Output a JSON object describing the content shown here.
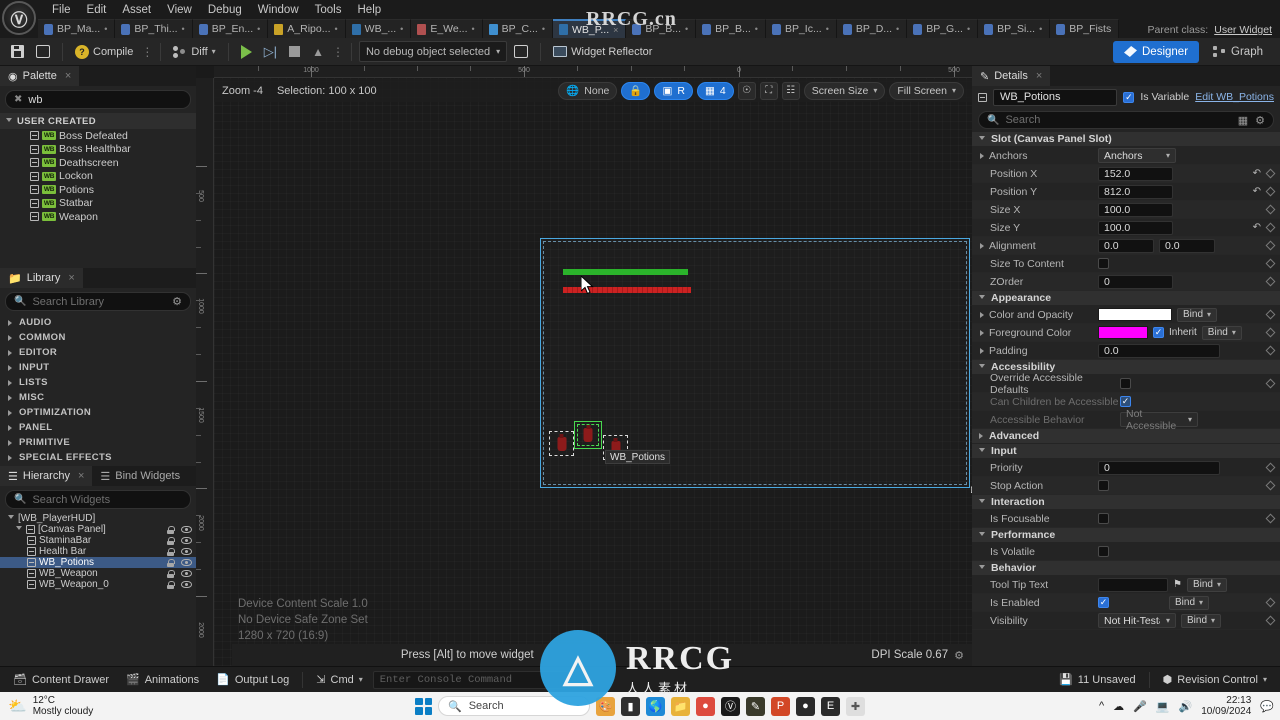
{
  "app": {
    "logo": "unreal-engine-logo",
    "menu": [
      "File",
      "Edit",
      "Asset",
      "View",
      "Debug",
      "Window",
      "Tools",
      "Help"
    ],
    "parent_class_label": "Parent class:",
    "parent_class_value": "User Widget"
  },
  "tabs": [
    {
      "label": "BP_Ma...",
      "icon": "blueprint-icon",
      "active": false,
      "dirty": false
    },
    {
      "label": "BP_Thi...",
      "icon": "blueprint-icon",
      "active": false,
      "dirty": false
    },
    {
      "label": "BP_En...",
      "icon": "blueprint-icon",
      "active": false,
      "dirty": false
    },
    {
      "label": "A_Ripo...",
      "icon": "animation-icon",
      "active": false,
      "dirty": false
    },
    {
      "label": "WB_...",
      "icon": "widget-icon",
      "active": false,
      "dirty": true
    },
    {
      "label": "E_We...",
      "icon": "enum-icon",
      "active": false,
      "dirty": true
    },
    {
      "label": "BP_C...",
      "icon": "curve-icon",
      "active": false,
      "dirty": true
    },
    {
      "label": "WB_P...",
      "icon": "widget-icon",
      "active": true,
      "dirty": false,
      "close": "x"
    },
    {
      "label": "BP_B...",
      "icon": "blueprint-icon",
      "active": false,
      "dirty": true
    },
    {
      "label": "BP_B...",
      "icon": "blueprint-icon",
      "active": false,
      "dirty": true
    },
    {
      "label": "BP_Ic...",
      "icon": "blueprint-icon",
      "active": false,
      "dirty": true
    },
    {
      "label": "BP_D...",
      "icon": "blueprint-icon",
      "active": false,
      "dirty": true
    },
    {
      "label": "BP_G...",
      "icon": "blueprint-icon",
      "active": false,
      "dirty": true
    },
    {
      "label": "BP_Si...",
      "icon": "blueprint-icon",
      "active": false,
      "dirty": true
    },
    {
      "label": "BP_Fists",
      "icon": "blueprint-icon",
      "active": false,
      "dirty": false
    }
  ],
  "toolbar": {
    "save_label": "",
    "browse_label": "",
    "compile_label": "Compile",
    "diff_label": "Diff",
    "debug_object": "No debug object selected",
    "widget_reflector": "Widget Reflector",
    "designer_label": "Designer",
    "graph_label": "Graph"
  },
  "palette": {
    "tab_label": "Palette",
    "search_value": "wb",
    "category": "USER CREATED",
    "items": [
      {
        "label": "Boss Defeated",
        "badge": "WB"
      },
      {
        "label": "Boss Healthbar",
        "badge": "WB"
      },
      {
        "label": "Deathscreen",
        "badge": "WB"
      },
      {
        "label": "Lockon",
        "badge": "WB"
      },
      {
        "label": "Potions",
        "badge": "WB"
      },
      {
        "label": "Statbar",
        "badge": "WB"
      },
      {
        "label": "Weapon",
        "badge": "WB"
      }
    ]
  },
  "library": {
    "tab_label": "Library",
    "search_placeholder": "Search Library",
    "categories": [
      "AUDIO",
      "COMMON",
      "EDITOR",
      "INPUT",
      "LISTS",
      "MISC",
      "OPTIMIZATION",
      "PANEL",
      "PRIMITIVE",
      "SPECIAL EFFECTS"
    ]
  },
  "hierarchy": {
    "tab_label": "Hierarchy",
    "tab_label_2": "Bind Widgets",
    "search_placeholder": "Search Widgets",
    "items": [
      {
        "label": "[WB_PlayerHUD]",
        "depth": 0,
        "selected": false,
        "controls": false
      },
      {
        "label": "[Canvas Panel]",
        "depth": 1,
        "selected": false,
        "controls": true
      },
      {
        "label": "StaminaBar",
        "depth": 2,
        "selected": false,
        "controls": true
      },
      {
        "label": "Health Bar",
        "depth": 2,
        "selected": false,
        "controls": true
      },
      {
        "label": "WB_Potions",
        "depth": 2,
        "selected": true,
        "controls": true
      },
      {
        "label": "WB_Weapon",
        "depth": 2,
        "selected": false,
        "controls": true
      },
      {
        "label": "WB_Weapon_0",
        "depth": 2,
        "selected": false,
        "controls": true
      }
    ]
  },
  "viewport": {
    "zoom_label": "Zoom -4",
    "selection_label": "Selection: 100 x 100",
    "none_label": "None",
    "grid_snap_value": "4",
    "rotation_label": "R",
    "screen_size_label": "Screen Size",
    "fill_screen_label": "Fill Screen",
    "device_content_scale": "Device Content Scale 1.0",
    "safe_zone": "No Device Safe Zone Set",
    "resolution": "1280 x 720 (16:9)",
    "hint": "Press [Alt] to move widget",
    "dpi_scale": "DPI Scale 0.67",
    "selected_widget_tag": "WB_Potions",
    "ruler_h_labels": [
      "1000",
      "500",
      "0",
      "500"
    ],
    "ruler_v_labels": [
      "500",
      "1000",
      "1500",
      "2000"
    ],
    "selection_color": "#4aa8e0",
    "widget_select_color": "#49d94f"
  },
  "details": {
    "tab_label": "Details",
    "widget_name": "WB_Potions",
    "is_variable_label": "Is Variable",
    "is_variable_checked": true,
    "edit_link": "Edit WB_Potions",
    "search_placeholder": "Search",
    "sections": [
      {
        "title": "Slot (Canvas Panel Slot)",
        "rows": [
          {
            "label": "Anchors",
            "type": "select",
            "value": "Anchors",
            "expand": true,
            "reset": false,
            "diamond": false
          },
          {
            "label": "Position X",
            "type": "text",
            "value": "152.0",
            "reset": true,
            "diamond": true
          },
          {
            "label": "Position Y",
            "type": "text",
            "value": "812.0",
            "reset": true,
            "diamond": true
          },
          {
            "label": "Size X",
            "type": "text",
            "value": "100.0",
            "reset": false,
            "diamond": true
          },
          {
            "label": "Size Y",
            "type": "text",
            "value": "100.0",
            "reset": true,
            "diamond": true
          },
          {
            "label": "Alignment",
            "type": "vec2",
            "value": "0.0",
            "value2": "0.0",
            "expand": true,
            "reset": false,
            "diamond": true
          },
          {
            "label": "Size To Content",
            "type": "check",
            "checked": false,
            "reset": false,
            "diamond": true
          },
          {
            "label": "ZOrder",
            "type": "text",
            "value": "0",
            "reset": false,
            "diamond": true
          }
        ]
      },
      {
        "title": "Appearance",
        "rows": [
          {
            "label": "Color and Opacity",
            "type": "color",
            "color": "#ffffff",
            "bind": "Bind",
            "expand": true,
            "diamond": true
          },
          {
            "label": "Foreground Color",
            "type": "color",
            "color": "#ff00ff",
            "inherit_label": "Inherit",
            "inherit_checked": true,
            "bind": "Bind",
            "expand": true,
            "diamond": true
          },
          {
            "label": "Padding",
            "type": "text",
            "value": "0.0",
            "expand": true,
            "wide": true,
            "diamond": true
          }
        ]
      },
      {
        "title": "Accessibility",
        "rows": [
          {
            "label": "Override Accessible Defaults",
            "type": "check",
            "checked": false,
            "diamond": true
          },
          {
            "label": "Can Children be Accessible",
            "type": "check",
            "checked": true,
            "dim": true,
            "diamond": false
          },
          {
            "label": "Accessible Behavior",
            "type": "select",
            "value": "Not Accessible",
            "dim": true,
            "diamond": false
          }
        ]
      },
      {
        "title": "Advanced",
        "collapsed": true,
        "rows": []
      },
      {
        "title": "Input",
        "rows": [
          {
            "label": "Priority",
            "type": "text",
            "value": "0",
            "diamond": true
          },
          {
            "label": "Stop Action",
            "type": "check",
            "checked": false,
            "diamond": true
          }
        ]
      },
      {
        "title": "Interaction",
        "rows": [
          {
            "label": "Is Focusable",
            "type": "check",
            "checked": false,
            "diamond": true
          }
        ]
      },
      {
        "title": "Performance",
        "rows": [
          {
            "label": "Is Volatile",
            "type": "check",
            "checked": false,
            "diamond": false
          }
        ]
      },
      {
        "title": "Behavior",
        "rows": [
          {
            "label": "Tool Tip Text",
            "type": "text",
            "value": "",
            "flag": true,
            "bind": "Bind",
            "diamond": false
          },
          {
            "label": "Is Enabled",
            "type": "check",
            "checked": true,
            "bind": "Bind",
            "diamond": true
          },
          {
            "label": "Visibility",
            "type": "select",
            "value": "Not Hit-Testable (S",
            "bind": "Bind",
            "diamond": true
          }
        ]
      }
    ]
  },
  "statusbar": {
    "content_drawer": "Content Drawer",
    "animations": "Animations",
    "output_log": "Output Log",
    "cmd_label": "Cmd",
    "console_placeholder": "Enter Console Command",
    "unsaved": "11 Unsaved",
    "revision_control": "Revision Control"
  },
  "taskbar": {
    "weather_temp": "12°C",
    "weather_desc": "Mostly cloudy",
    "search_placeholder": "Search",
    "time": "22:13",
    "date": "10/09/2024",
    "icons": [
      "start-icon",
      "search-icon",
      "paint-icon",
      "terminal-icon",
      "edge-icon",
      "folder-icon",
      "chrome-icon",
      "unreal-icon",
      "notes-icon",
      "powerpoint-icon",
      "blender-icon",
      "epic-icon",
      "tool-icon"
    ]
  },
  "watermark": {
    "top": "RRCG.cn",
    "big": "RRCG",
    "small": "人人素材"
  }
}
